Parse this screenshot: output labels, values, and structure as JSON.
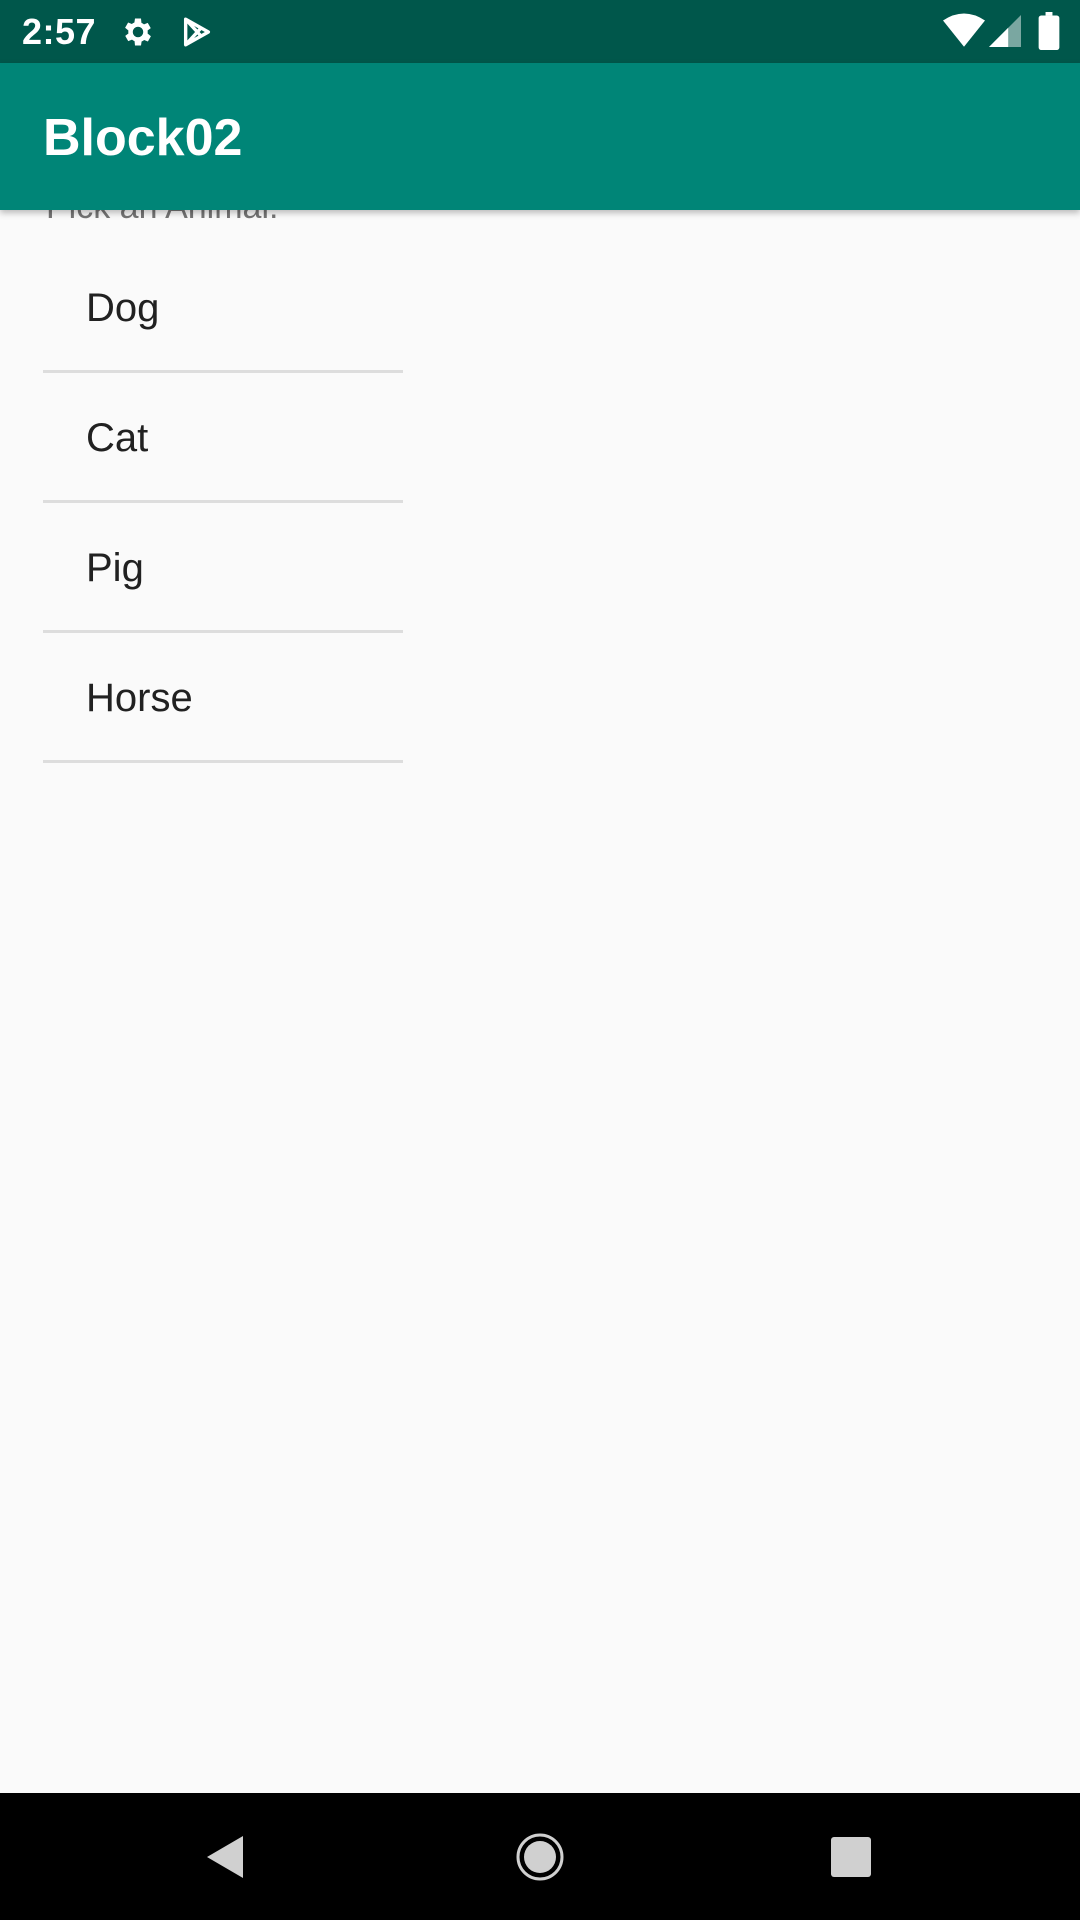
{
  "status_bar": {
    "time": "2:57",
    "icons": [
      "settings-icon",
      "play-store-icon",
      "wifi-icon",
      "signal-icon",
      "battery-icon"
    ]
  },
  "app_bar": {
    "title": "Block02",
    "color": "#008577"
  },
  "main": {
    "prompt": "Pick an Animal:",
    "animals": [
      "Dog",
      "Cat",
      "Pig",
      "Horse"
    ]
  },
  "nav_bar": {
    "buttons": [
      "back-icon",
      "home-icon",
      "recents-icon"
    ]
  }
}
